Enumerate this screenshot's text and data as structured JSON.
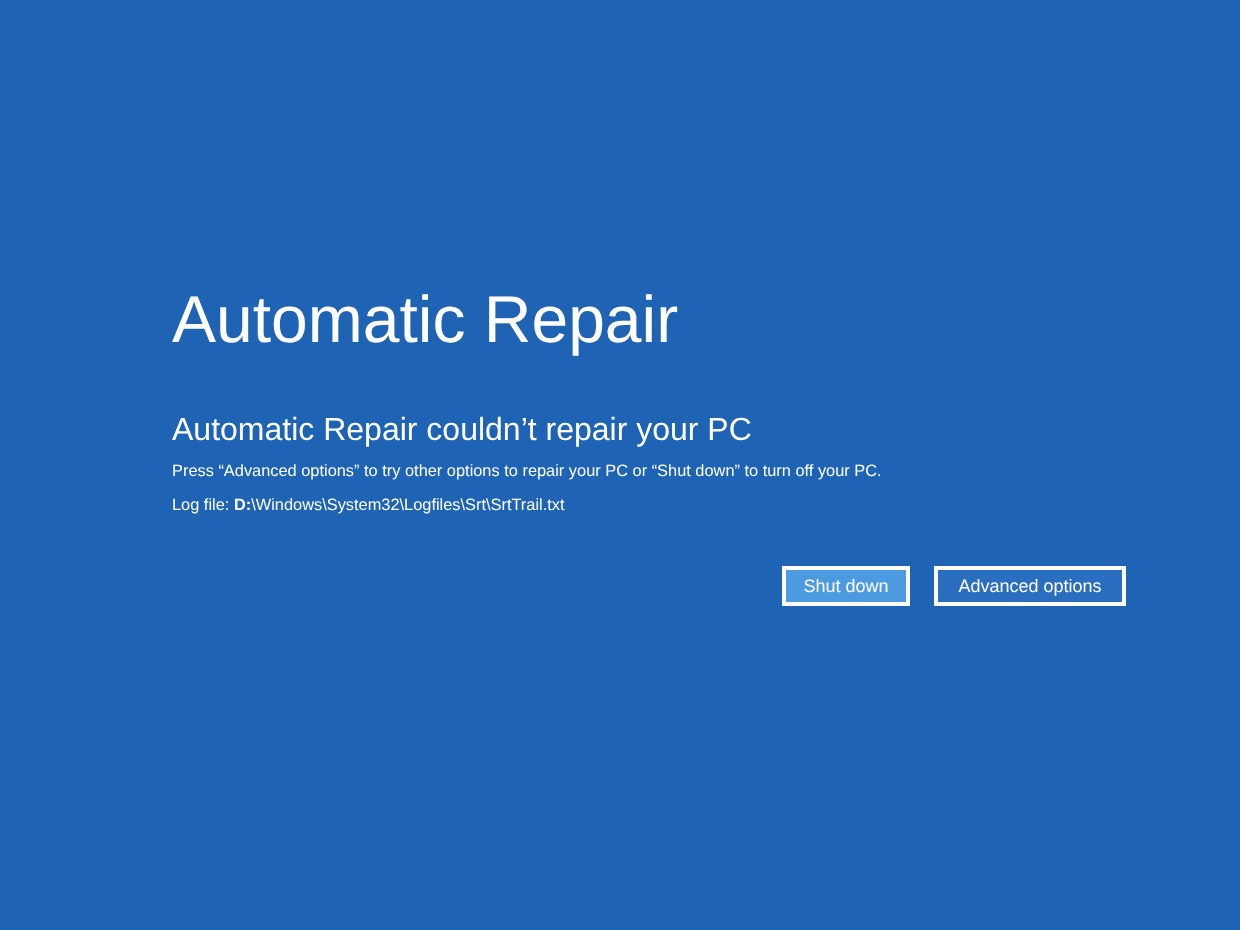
{
  "title": "Automatic Repair",
  "heading": "Automatic Repair couldn’t repair your PC",
  "message": "Press “Advanced options” to try other options to repair your PC or “Shut down” to turn off your PC.",
  "log_file": "Log file: **D:**\\Windows\\System32\\Logfiles\\Srt\\SrtTrail.txt",
  "buttons": [
    {
      "label": "Shut down",
      "selected": true
    },
    {
      "label": "Advanced options",
      "selected": false
    }
  ]
}
